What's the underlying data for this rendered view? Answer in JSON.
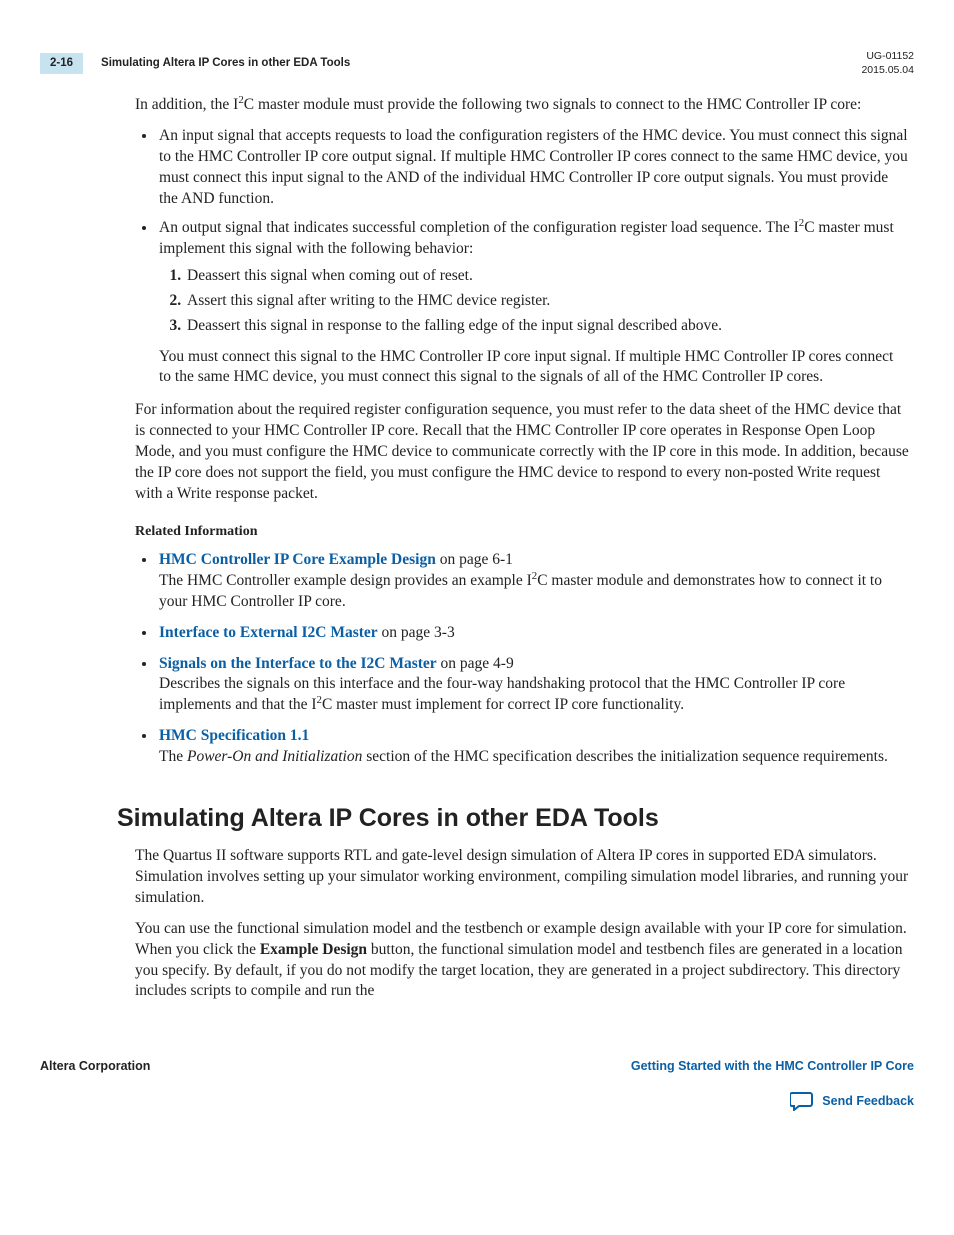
{
  "header": {
    "page_num": "2-16",
    "running_title": "Simulating Altera IP Cores in other EDA Tools",
    "doc_id": "UG-01152",
    "date": "2015.05.04"
  },
  "intro_pre": "In addition, the I",
  "intro_sup": "2",
  "intro_post": "C master module must provide the following two signals to connect to the HMC Controller IP core:",
  "bullets": {
    "b1": "An input signal that accepts requests to load the configuration registers of the HMC device. You must connect this signal to the HMC Controller IP core                                        output signal. If multiple HMC Controller IP cores connect to the same HMC device, you must connect this input signal to the AND of the individual HMC Controller IP core                                       output signals. You must provide the AND function.",
    "b2_pre": "An output signal that indicates successful completion of the configuration register load sequence. The I",
    "b2_sup": "2",
    "b2_post": "C master must implement this signal with the following behavior:",
    "steps": {
      "s1": "Deassert this signal when coming out of reset.",
      "s2": "Assert this signal after writing                          to the HMC device                                register.",
      "s3": "Deassert this signal in response to the falling edge of the input signal described above."
    },
    "b2_follow": "You must connect this signal to the HMC Controller IP core                                    input signal. If multiple HMC Controller IP cores connect to the same HMC device, you must connect this signal to the                                    signals of all of the HMC Controller IP cores."
  },
  "para2": "For information about the required register configuration sequence, you must refer to the data sheet of the HMC device that is connected to your HMC Controller IP core. Recall that the HMC Controller IP core operates in Response Open Loop Mode, and you must configure the HMC device to communicate correctly with the IP core in this mode. In addition, because the IP core does not support the        field, you must configure the HMC device to respond to every non-posted Write request with a Write response packet.",
  "related_heading": "Related Information",
  "related": [
    {
      "title": "HMC Controller IP Core Example Design",
      "suffix": " on page 6-1",
      "desc_pre": "The HMC Controller example design provides an example I",
      "desc_sup": "2",
      "desc_post": "C master module and demonstrates how to connect it to your HMC Controller IP core."
    },
    {
      "title": "Interface to External I2C Master",
      "suffix": " on page 3-3",
      "desc_pre": "",
      "desc_sup": "",
      "desc_post": ""
    },
    {
      "title": "Signals on the Interface to the I2C Master",
      "suffix": " on page 4-9",
      "desc_pre": "Describes the signals on this interface and the four-way handshaking protocol that the HMC Controller IP core implements and that the I",
      "desc_sup": "2",
      "desc_post": "C master must implement for correct IP core functionality."
    },
    {
      "title": "HMC Specification 1.1",
      "suffix": "",
      "desc_pre": "The ",
      "desc_italic": "Power-On and Initialization",
      "desc_post2": " section of the HMC specification describes the initialization sequence requirements."
    }
  ],
  "h2": "Simulating Altera IP Cores in other EDA Tools",
  "sim_p1": "The Quartus II software supports RTL and gate-level design simulation of Altera IP cores in supported EDA simulators. Simulation involves setting up your simulator working environment, compiling simulation model libraries, and running your simulation.",
  "sim_p2_pre": "You can use the functional simulation model and the testbench or example design available with your IP core for simulation. When you click the ",
  "sim_p2_bold": "Example Design",
  "sim_p2_post": " button, the functional simulation model and testbench files are generated in a location you specify. By default, if you do not modify the target location, they are generated in a project subdirectory. This directory includes scripts to compile and run the",
  "footer": {
    "left": "Altera Corporation",
    "right": "Getting Started with the HMC Controller IP Core",
    "feedback": "Send Feedback"
  }
}
